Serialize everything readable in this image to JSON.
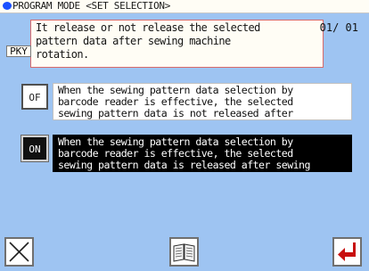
{
  "title": "PROGRAM MODE <SET SELECTION>",
  "page_count": "01/ 01",
  "info": {
    "key_label": "PKY",
    "text": "It release or not release the selected\npattern data after sewing machine\nrotation."
  },
  "options": [
    {
      "id": "off",
      "label": "OF",
      "description": "When the sewing pattern data selection by\nbarcode reader is effective, the selected\nsewing pattern data is not released after",
      "selected": false
    },
    {
      "id": "on",
      "label": "ON",
      "description": "When the sewing pattern data selection by\nbarcode reader is effective, the selected\nsewing pattern data is released after sewing",
      "selected": true
    }
  ],
  "buttons": {
    "cancel_icon": "close-x-icon",
    "manual_icon": "open-book-icon",
    "enter_icon": "enter-return-icon"
  },
  "colors": {
    "background": "#9ec4f2",
    "panel": "#fffdf5",
    "info_border": "#d86a6a",
    "title_dot": "#1a50ff",
    "enter_arrow": "#c81010",
    "selected_bg": "#000000"
  }
}
